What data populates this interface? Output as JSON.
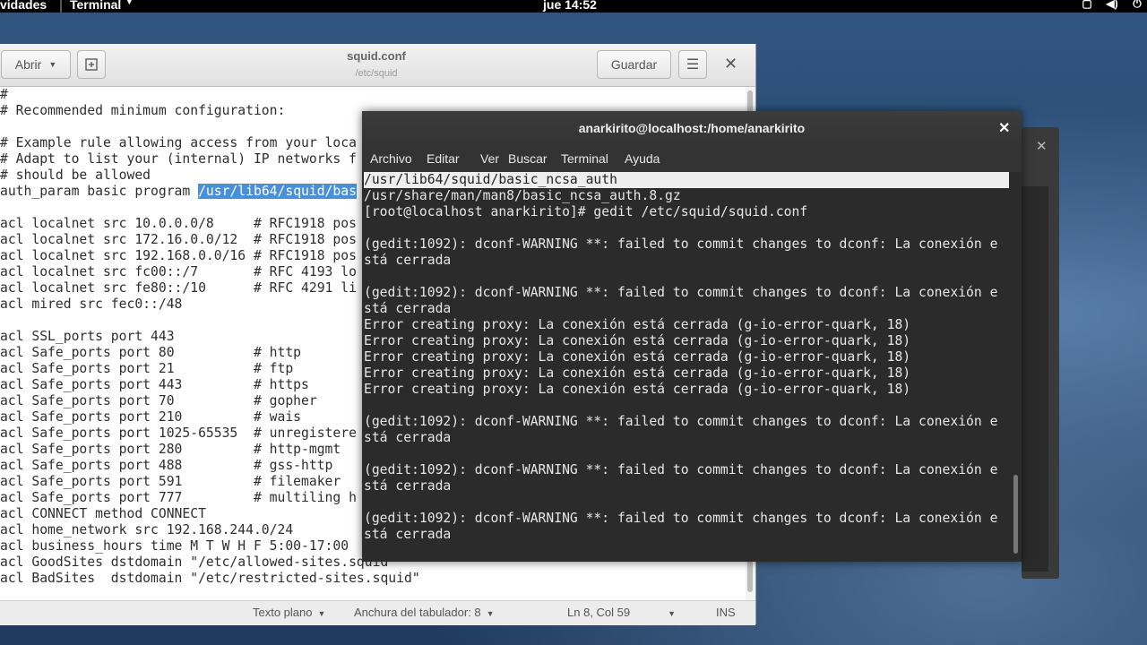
{
  "topbar": {
    "activities": "vidades",
    "app_menu": "Terminal",
    "clock": "jue 14:52",
    "tray_icons": [
      "window-icon",
      "volume-icon",
      "power-icon"
    ]
  },
  "gedit": {
    "open_label": "Abrir",
    "save_label": "Guardar",
    "title": "squid.conf",
    "subtitle": "/etc/squid",
    "lines": [
      "#",
      "# Recommended minimum configuration:",
      "",
      "# Example rule allowing access from your loca",
      "# Adapt to list your (internal) IP networks f",
      "# should be allowed",
      "auth_param basic program ",
      "",
      "acl localnet src 10.0.0.0/8     # RFC1918 pos",
      "acl localnet src 172.16.0.0/12  # RFC1918 pos",
      "acl localnet src 192.168.0.0/16 # RFC1918 pos",
      "acl localnet src fc00::/7       # RFC 4193 lo",
      "acl localnet src fe80::/10      # RFC 4291 li",
      "acl mired src fec0::/48",
      "",
      "acl SSL_ports port 443",
      "acl Safe_ports port 80          # http",
      "acl Safe_ports port 21          # ftp",
      "acl Safe_ports port 443         # https",
      "acl Safe_ports port 70          # gopher",
      "acl Safe_ports port 210         # wais",
      "acl Safe_ports port 1025-65535  # unregistere",
      "acl Safe_ports port 280         # http-mgmt",
      "acl Safe_ports port 488         # gss-http",
      "acl Safe_ports port 591         # filemaker",
      "acl Safe_ports port 777         # multiling h",
      "acl CONNECT method CONNECT",
      "acl home_network src 192.168.244.0/24",
      "acl business_hours time M T W H F 5:00-17:00",
      "acl GoodSites dstdomain \"/etc/allowed-sites.squid\"",
      "acl BadSites  dstdomain \"/etc/restricted-sites.squid\""
    ],
    "selected_text": "/usr/lib64/squid/bas",
    "status": {
      "syntax": "Texto plano",
      "tab_width": "Anchura del tabulador: 8",
      "position": "Ln 8, Col 59",
      "mode": "INS"
    }
  },
  "terminal": {
    "title": "anarkirito@localhost:/home/anarkirito",
    "menu": [
      "Archivo",
      "Editar",
      "Ver",
      "Buscar",
      "Terminal",
      "Ayuda"
    ],
    "lines": [
      "/usr/lib64/squid/basic_ncsa_auth",
      "/usr/share/man/man8/basic_ncsa_auth.8.gz",
      "[root@localhost anarkirito]# gedit /etc/squid/squid.conf",
      "",
      "(gedit:1092): dconf-WARNING **: failed to commit changes to dconf: La conexión e",
      "stá cerrada",
      "",
      "(gedit:1092): dconf-WARNING **: failed to commit changes to dconf: La conexión e",
      "stá cerrada",
      "Error creating proxy: La conexión está cerrada (g-io-error-quark, 18)",
      "Error creating proxy: La conexión está cerrada (g-io-error-quark, 18)",
      "Error creating proxy: La conexión está cerrada (g-io-error-quark, 18)",
      "Error creating proxy: La conexión está cerrada (g-io-error-quark, 18)",
      "Error creating proxy: La conexión está cerrada (g-io-error-quark, 18)",
      "",
      "(gedit:1092): dconf-WARNING **: failed to commit changes to dconf: La conexión e",
      "stá cerrada",
      "",
      "(gedit:1092): dconf-WARNING **: failed to commit changes to dconf: La conexión e",
      "stá cerrada",
      "",
      "(gedit:1092): dconf-WARNING **: failed to commit changes to dconf: La conexión e",
      "stá cerrada"
    ]
  }
}
